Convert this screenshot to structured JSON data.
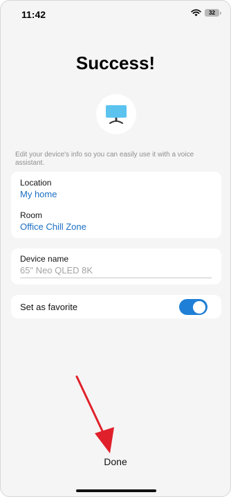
{
  "status_bar": {
    "time": "11:42",
    "battery": "32"
  },
  "title": "Success!",
  "device_icon": "tv-icon",
  "hint": "Edit your device's info so you can easily use it with a voice assistant.",
  "location": {
    "label": "Location",
    "value": "My home"
  },
  "room": {
    "label": "Room",
    "value": "Office Chill Zone"
  },
  "device_name": {
    "label": "Device name",
    "placeholder": "65\" Neo QLED 8K"
  },
  "favorite": {
    "label": "Set as favorite",
    "enabled": true
  },
  "done_label": "Done",
  "colors": {
    "accent": "#1f7fd6",
    "link": "#1a6fc4",
    "background": "#f5f5f5",
    "annotation_arrow": "#e0202a"
  }
}
